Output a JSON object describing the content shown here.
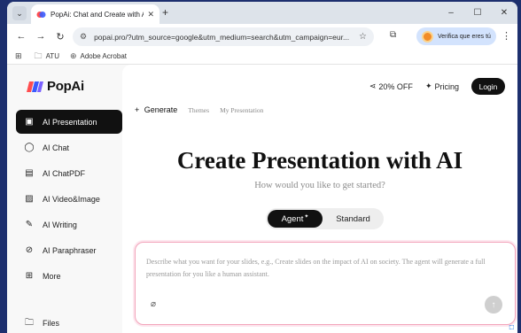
{
  "browser": {
    "tab_title": "PopAi: Chat and Create with AI",
    "url": "popai.pro/?utm_source=google&utm_medium=search&utm_campaign=eur...",
    "profile_label": "Verifica que eres tú",
    "bookmarks": [
      "ATU",
      "Adobe Acrobat"
    ]
  },
  "brand": {
    "name": "PopAi"
  },
  "sidebar": {
    "items": [
      {
        "label": "AI Presentation",
        "icon": "presentation-icon"
      },
      {
        "label": "AI Chat",
        "icon": "chat-bubble-icon"
      },
      {
        "label": "AI ChatPDF",
        "icon": "pdf-document-icon"
      },
      {
        "label": "AI Video&Image",
        "icon": "image-icon"
      },
      {
        "label": "AI Writing",
        "icon": "magic-wand-icon"
      },
      {
        "label": "AI Paraphraser",
        "icon": "paraphrase-icon"
      },
      {
        "label": "More",
        "icon": "grid-icon"
      }
    ],
    "files_label": "Files"
  },
  "topnav": {
    "promo": "20% OFF",
    "pricing": "Pricing",
    "login": "Login"
  },
  "subtabs": {
    "generate": "Generate",
    "themes": "Themes",
    "my_presentation": "My Presentation"
  },
  "main": {
    "title": "Create Presentation with AI",
    "subtitle": "How would you like to get started?",
    "mode_agent": "Agent",
    "mode_standard": "Standard",
    "placeholder": "Describe what you want for your slides, e.g., Create slides on the impact of AI on society. The agent will generate a full presentation for you like a human assistant."
  },
  "colors": {
    "accent_dark": "#111111",
    "logo_red": "#ff4d4f",
    "logo_blue": "#3b5bfd",
    "prompt_border": "#f2a3ba"
  }
}
